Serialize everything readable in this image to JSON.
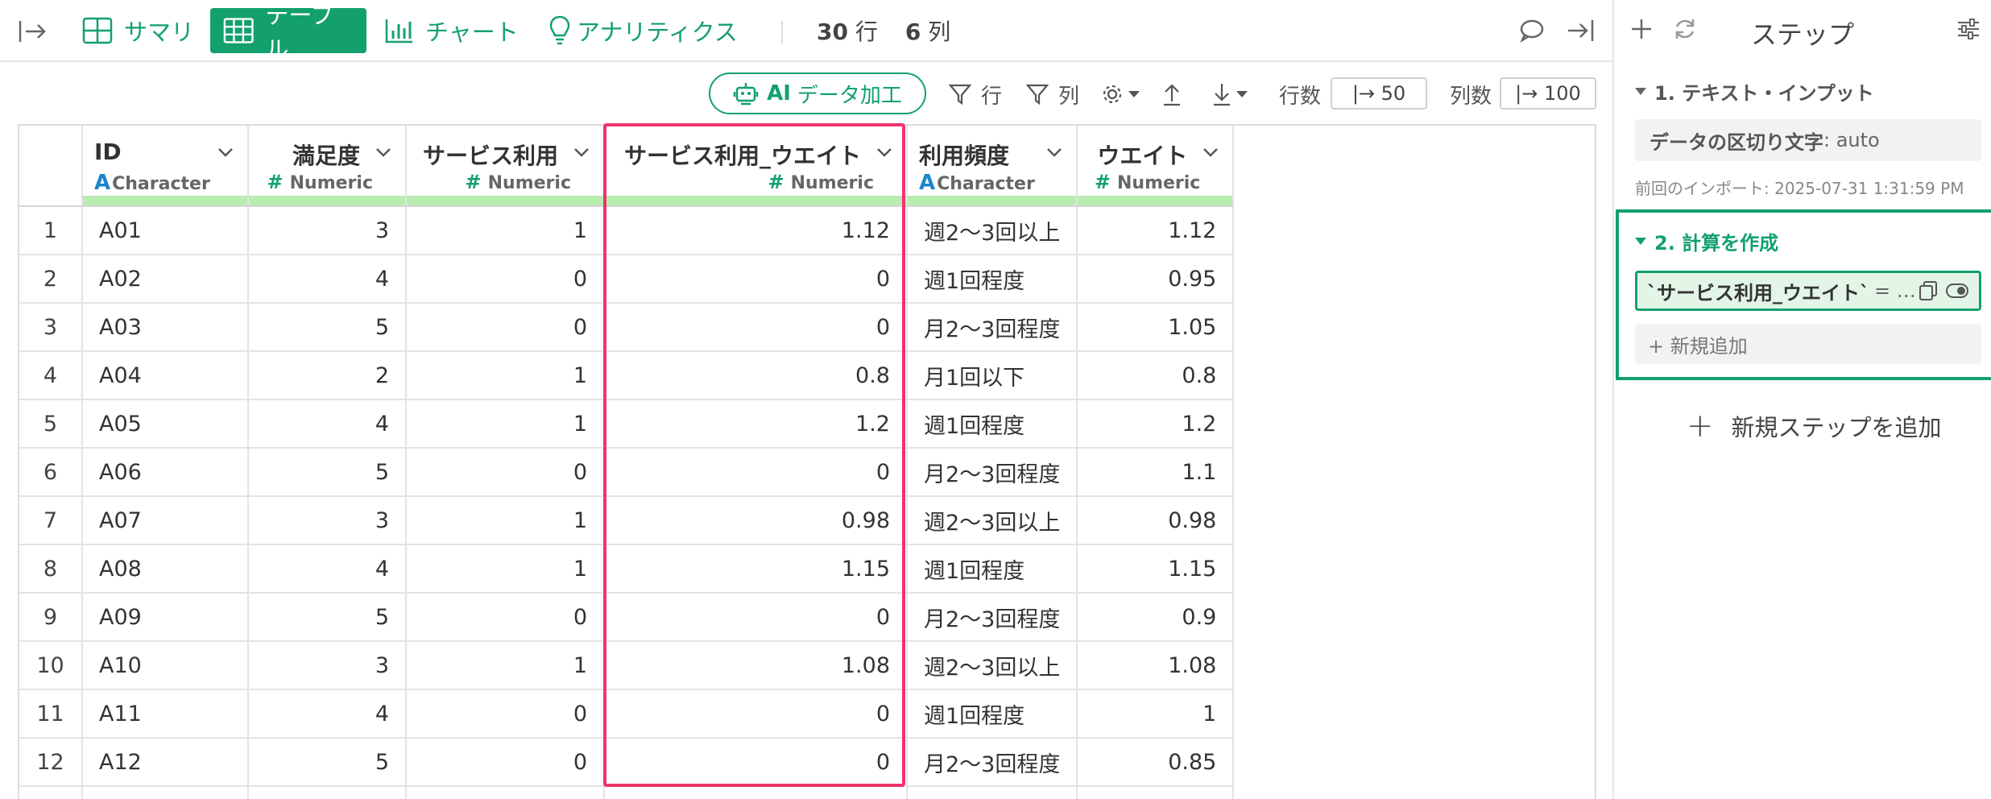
{
  "topbar": {
    "tabs": [
      {
        "label": "サマリ",
        "icon": "summary-grid-icon"
      },
      {
        "label": "テーブル",
        "icon": "table-icon",
        "active": true
      },
      {
        "label": "チャート",
        "icon": "bar-chart-icon"
      },
      {
        "label": "アナリティクス",
        "icon": "lightbulb-icon"
      }
    ],
    "rows_count": "30",
    "rows_unit": "行",
    "cols_count": "6",
    "cols_unit": "列"
  },
  "toolbar": {
    "ai_prefix": "AI",
    "ai_label": "データ加工",
    "filter_rows": "行",
    "filter_cols": "列",
    "rows_label": "行数",
    "rows_value": "|→ 50",
    "cols_label": "列数",
    "cols_value": "|→ 100"
  },
  "table": {
    "columns": [
      {
        "name": "ID",
        "type": "Character",
        "kind": "A"
      },
      {
        "name": "満足度",
        "type": "Numeric",
        "kind": "#"
      },
      {
        "name": "サービス利用",
        "type": "Numeric",
        "kind": "#"
      },
      {
        "name": "サービス利用_ウエイト",
        "type": "Numeric",
        "kind": "#"
      },
      {
        "name": "利用頻度",
        "type": "Character",
        "kind": "A"
      },
      {
        "name": "ウエイト",
        "type": "Numeric",
        "kind": "#"
      }
    ],
    "rows": [
      [
        "1",
        "A01",
        "3",
        "1",
        "1.12",
        "週2〜3回以上",
        "1.12"
      ],
      [
        "2",
        "A02",
        "4",
        "0",
        "0",
        "週1回程度",
        "0.95"
      ],
      [
        "3",
        "A03",
        "5",
        "0",
        "0",
        "月2〜3回程度",
        "1.05"
      ],
      [
        "4",
        "A04",
        "2",
        "1",
        "0.8",
        "月1回以下",
        "0.8"
      ],
      [
        "5",
        "A05",
        "4",
        "1",
        "1.2",
        "週1回程度",
        "1.2"
      ],
      [
        "6",
        "A06",
        "5",
        "0",
        "0",
        "月2〜3回程度",
        "1.1"
      ],
      [
        "7",
        "A07",
        "3",
        "1",
        "0.98",
        "週2〜3回以上",
        "0.98"
      ],
      [
        "8",
        "A08",
        "4",
        "1",
        "1.15",
        "週1回程度",
        "1.15"
      ],
      [
        "9",
        "A09",
        "5",
        "0",
        "0",
        "月2〜3回程度",
        "0.9"
      ],
      [
        "10",
        "A10",
        "3",
        "1",
        "1.08",
        "週2〜3回以上",
        "1.08"
      ],
      [
        "11",
        "A11",
        "4",
        "0",
        "0",
        "週1回程度",
        "1"
      ],
      [
        "12",
        "A12",
        "5",
        "0",
        "0",
        "月2〜3回程度",
        "0.85"
      ]
    ]
  },
  "steps_panel": {
    "title": "ステップ",
    "step1": {
      "title": "1. テキスト・インプット",
      "setting_label": "データの区切り文字",
      "setting_value": ": auto",
      "note": "前回のインポート: 2025-07-31 1:31:59 PM"
    },
    "step2": {
      "title": "2. 計算を作成",
      "expr": "`サービス利用_ウエイト`",
      "expr_suffix": "= …",
      "add_label": "+ 新規追加"
    },
    "add_step_label": "新規ステップを追加"
  },
  "colors": {
    "accent": "#13a06d",
    "highlight": "#f0336b",
    "type_bar": "#b8ecb1",
    "character_type": "#1a87c9"
  }
}
